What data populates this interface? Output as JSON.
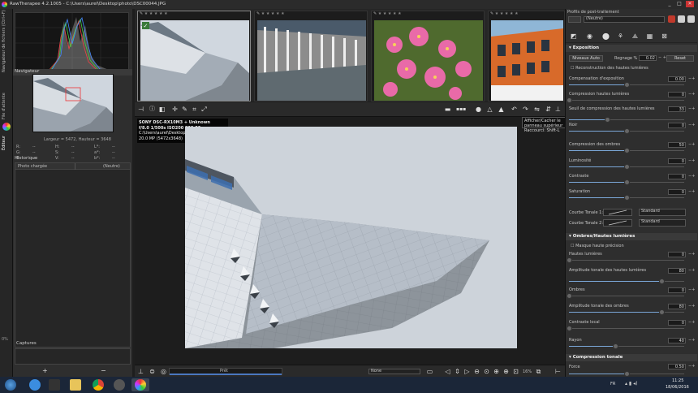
{
  "window": {
    "title": "RawTherapee 4.2.1005 - C:\\Users\\aurel\\Desktop\\photo\\DSC00044.JPG",
    "controls": [
      "_",
      "□",
      "✕"
    ]
  },
  "left_tabs": {
    "navigator_tab": "Navigateur de fichiers (Ctrl+F)",
    "queue_tab": "File d'attente",
    "editor_tab": "Éditeur"
  },
  "navigator": {
    "title": "Navigateur",
    "dims": "Largeur = 5472, Hauteur = 3648",
    "channels_left": [
      "R:",
      "G:",
      "B:"
    ],
    "channels_mid": [
      "H:",
      "S:",
      "V:"
    ],
    "channels_right": [
      "L*:",
      "a*:",
      "b*:"
    ],
    "dash": "--"
  },
  "history": {
    "title": "Historique",
    "row_label": "Photo chargée",
    "row_value": "(Neutre)",
    "zoom": "0%"
  },
  "snapshots": {
    "title": "Captures",
    "add": "+",
    "remove": "−"
  },
  "filmstrip": {
    "stars": "★ ★ ★ ★ ★"
  },
  "exif": {
    "line1": "SONY DSC-RX10M3 + Unknown",
    "line2": "f/8.0  1/500s  ISO200  220.00mm",
    "line3": "C:\\Users\\aurel\\Desktop\\photo\\DSC00044.JPG",
    "line4": "20.0 MP (5472x3648)"
  },
  "tooltip": {
    "line1": "Afficher/Cacher le panneau supérieur",
    "line2": "Raccourci: Shift-L"
  },
  "status": {
    "progress_label": "Prêt",
    "progress_fraction": 1.0,
    "profile_combo": "None",
    "zoom": "16%"
  },
  "right": {
    "profile_title": "Profils de post-traitement",
    "profile_value": "(Neutre)",
    "exposure_head": "Exposition",
    "auto_btn": "Niveaux Auto",
    "clip_label": "Rognage %",
    "clip_value": "0.02",
    "reset_btn": "Reset",
    "recon": "Reconstruction des hautes lumières",
    "sliders": [
      {
        "label": "Compensation d'exposition",
        "value": "0.00",
        "pos": 0.5
      },
      {
        "label": "Compression hautes lumières",
        "value": "0",
        "pos": 0.0
      },
      {
        "label": "Seuil de compression des hautes lumières",
        "value": "33",
        "pos": 0.33
      },
      {
        "label": "Noir",
        "value": "0",
        "pos": 0.5
      },
      {
        "label": "Compression des ombres",
        "value": "50",
        "pos": 0.5
      },
      {
        "label": "Luminosité",
        "value": "0",
        "pos": 0.5
      },
      {
        "label": "Contraste",
        "value": "0",
        "pos": 0.5
      },
      {
        "label": "Saturation",
        "value": "0",
        "pos": 0.5
      }
    ],
    "curve1_label": "Courbe Tonale 1:",
    "curve2_label": "Courbe Tonale 2:",
    "curve_mode": "Standard",
    "sh_head": "Ombres/Hautes lumières",
    "sh_check": "Masque haute précision",
    "sh_sliders": [
      {
        "label": "Hautes lumières",
        "value": "0",
        "pos": 0.0
      },
      {
        "label": "Amplitude tonale des hautes lumières",
        "value": "80",
        "pos": 0.8
      },
      {
        "label": "Ombres",
        "value": "0",
        "pos": 0.0
      },
      {
        "label": "Amplitude tonale des ombres",
        "value": "80",
        "pos": 0.8
      },
      {
        "label": "Contraste local",
        "value": "0",
        "pos": 0.0
      },
      {
        "label": "Rayon",
        "value": "40",
        "pos": 0.4
      }
    ],
    "tc_head": "Compression tonale",
    "tc_force_label": "Force",
    "tc_force_value": "0.50"
  },
  "taskbar": {
    "lang": "FR",
    "time": "11:25",
    "date": "18/06/2016"
  },
  "colors": {
    "accent": "#7ba7d8",
    "panel": "#2e2e2e",
    "taskbar": "#1b2638"
  }
}
